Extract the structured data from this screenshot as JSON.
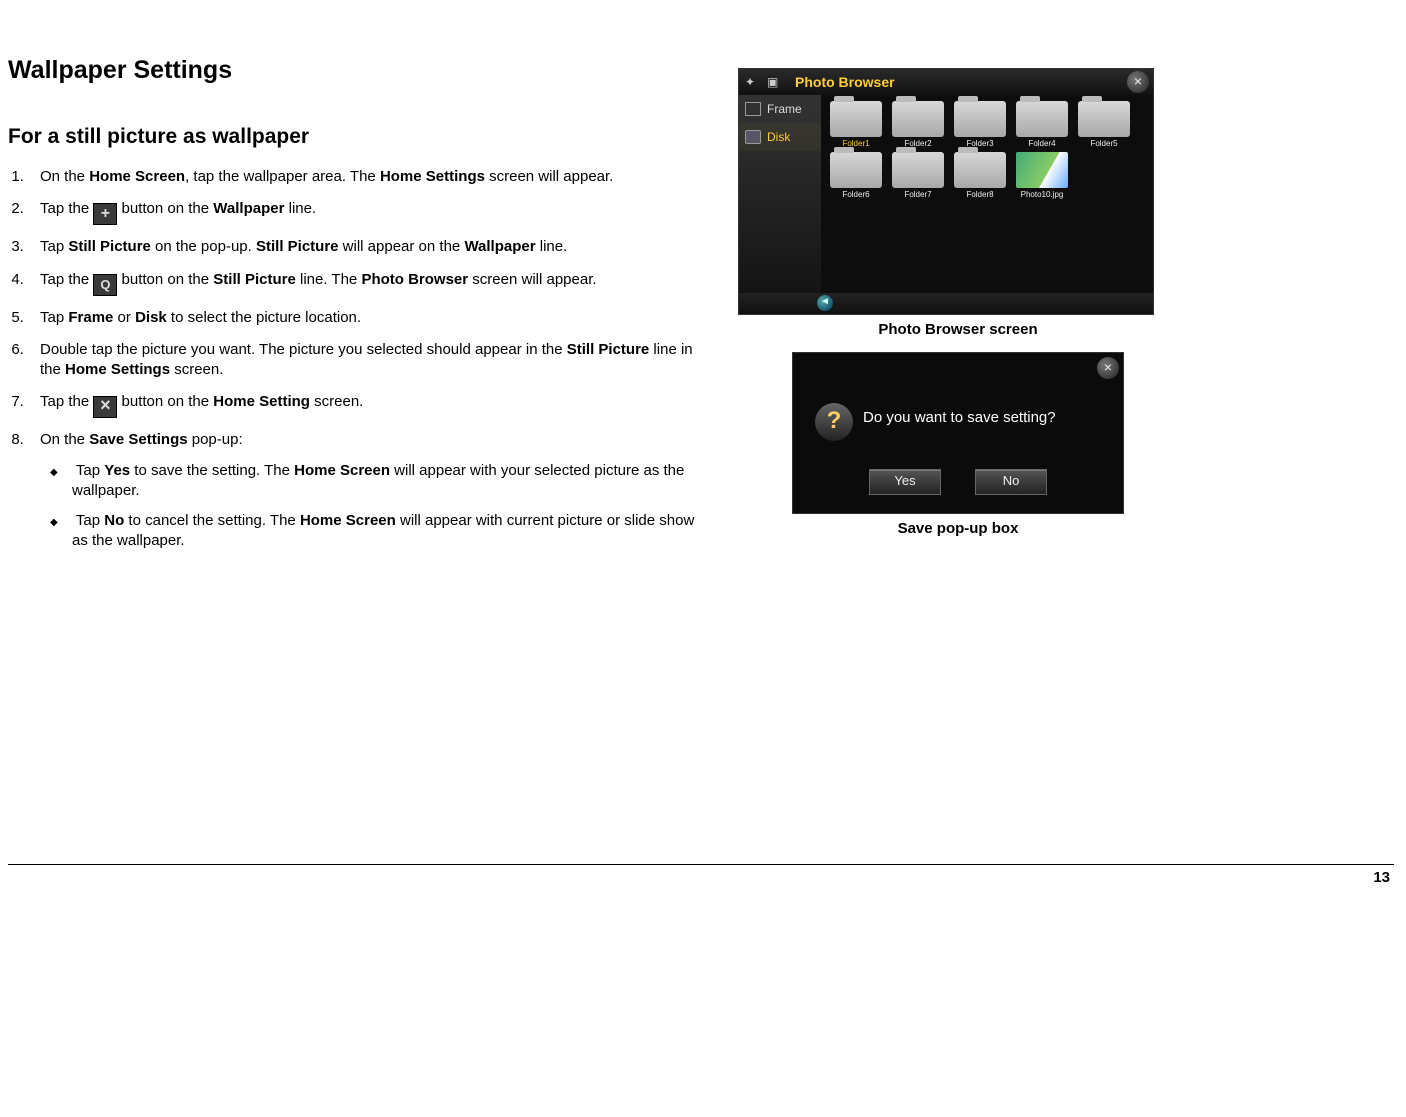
{
  "title": "Wallpaper Settings",
  "subtitle": "For a still picture as wallpaper",
  "steps": {
    "s1a": "On the ",
    "s1b": "Home Screen",
    "s1c": ", tap the wallpaper area.  The ",
    "s1d": "Home Settings",
    "s1e": " screen will appear.",
    "s2a": "Tap the ",
    "s2b": " button on the ",
    "s2c": "Wallpaper",
    "s2d": " line.",
    "s3a": "Tap ",
    "s3b": "Still Picture",
    "s3c": " on the pop-up.  ",
    "s3d": "Still Picture",
    "s3e": " will appear on the ",
    "s3f": "Wallpaper",
    "s3g": " line.",
    "s4a": "Tap the ",
    "s4b": " button on the ",
    "s4c": "Still Picture",
    "s4d": " line.  The ",
    "s4e": "Photo Browser",
    "s4f": " screen will appear.",
    "s5a": "Tap ",
    "s5b": "Frame",
    "s5c": " or ",
    "s5d": "Disk",
    "s5e": " to select the picture location.",
    "s6a": "Double tap the picture you want.  The picture you selected should appear in the ",
    "s6b": "Still Picture",
    "s6c": " line in the ",
    "s6d": "Home Settings",
    "s6e": " screen.",
    "s7a": "Tap the ",
    "s7b": " button on the ",
    "s7c": "Home Setting",
    "s7d": " screen.",
    "s8a": "On the ",
    "s8b": "Save Settings",
    "s8c": " pop-up:"
  },
  "bullets": {
    "b1a": "Tap ",
    "b1b": "Yes",
    "b1c": " to save the setting.  The ",
    "b1d": "Home Screen",
    "b1e": " will appear with your selected picture as the wallpaper.",
    "b2a": "Tap ",
    "b2b": "No",
    "b2c": " to cancel the setting.  The ",
    "b2d": "Home Screen",
    "b2e": " will appear with current picture or slide show as the wallpaper."
  },
  "photoBrowser": {
    "title": "Photo Browser",
    "sidebar": {
      "frame": "Frame",
      "disk": "Disk"
    },
    "folders": [
      "Folder1",
      "Folder2",
      "Folder3",
      "Folder4",
      "Folder5",
      "Folder6",
      "Folder7",
      "Folder8"
    ],
    "photo": "Photo10.jpg",
    "caption": "Photo Browser screen"
  },
  "savePopup": {
    "text": "Do you want to save setting?",
    "yes": "Yes",
    "no": "No",
    "caption": "Save pop-up box"
  },
  "pageNumber": "13"
}
